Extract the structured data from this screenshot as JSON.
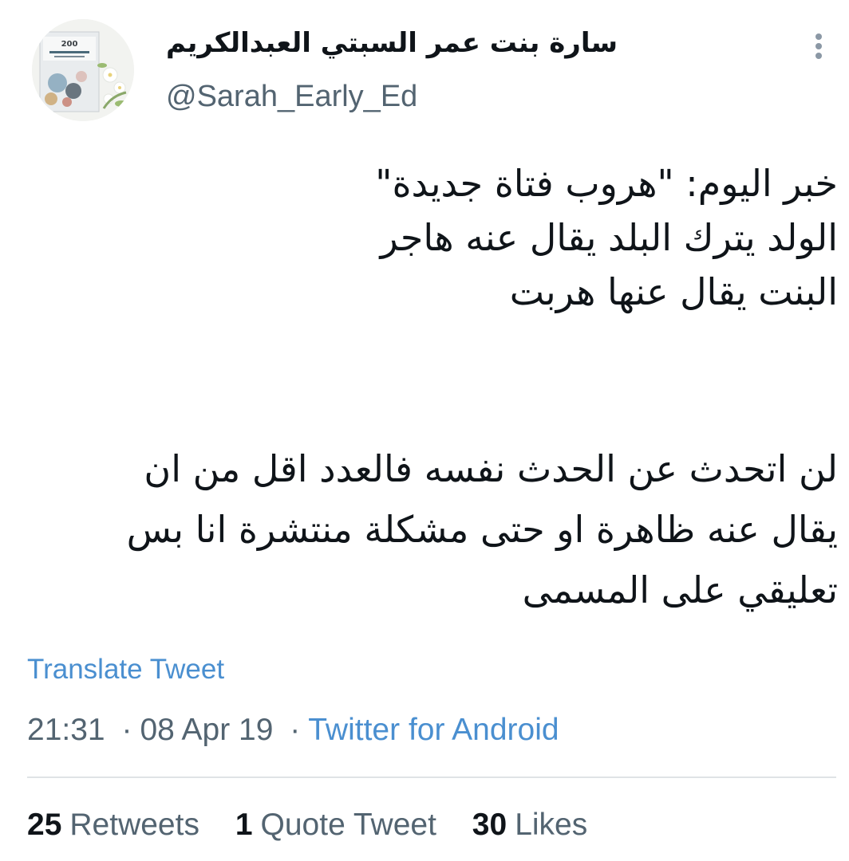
{
  "author": {
    "display_name": "سارة بنت عمر السبتي العبدالكريم",
    "handle": "@Sarah_Early_Ed",
    "avatar_book_number": "200"
  },
  "more_icon": "more-vertical-icon",
  "tweet": {
    "lines_p1": [
      "خبر اليوم: \"هروب فتاة جديدة\"",
      "الولد يترك البلد يقال عنه هاجر",
      "البنت يقال عنها هربت"
    ],
    "lines_p2": [
      "لن اتحدث عن الحدث نفسه فالعدد اقل من ان",
      "يقال عنه ظاهرة او حتى مشكلة منتشرة انا بس",
      "تعليقي على المسمى"
    ]
  },
  "translate_label": "Translate Tweet",
  "meta": {
    "time": "21:31",
    "separator": "·",
    "date": "08 Apr 19",
    "source": "Twitter for Android"
  },
  "stats": {
    "retweets_count": "25",
    "retweets_label": "Retweets",
    "quotes_count": "1",
    "quotes_label": "Quote Tweet",
    "likes_count": "30",
    "likes_label": "Likes"
  },
  "colors": {
    "link": "#4a8fd0",
    "secondary_text": "#536471",
    "primary_text": "#0f1419"
  }
}
